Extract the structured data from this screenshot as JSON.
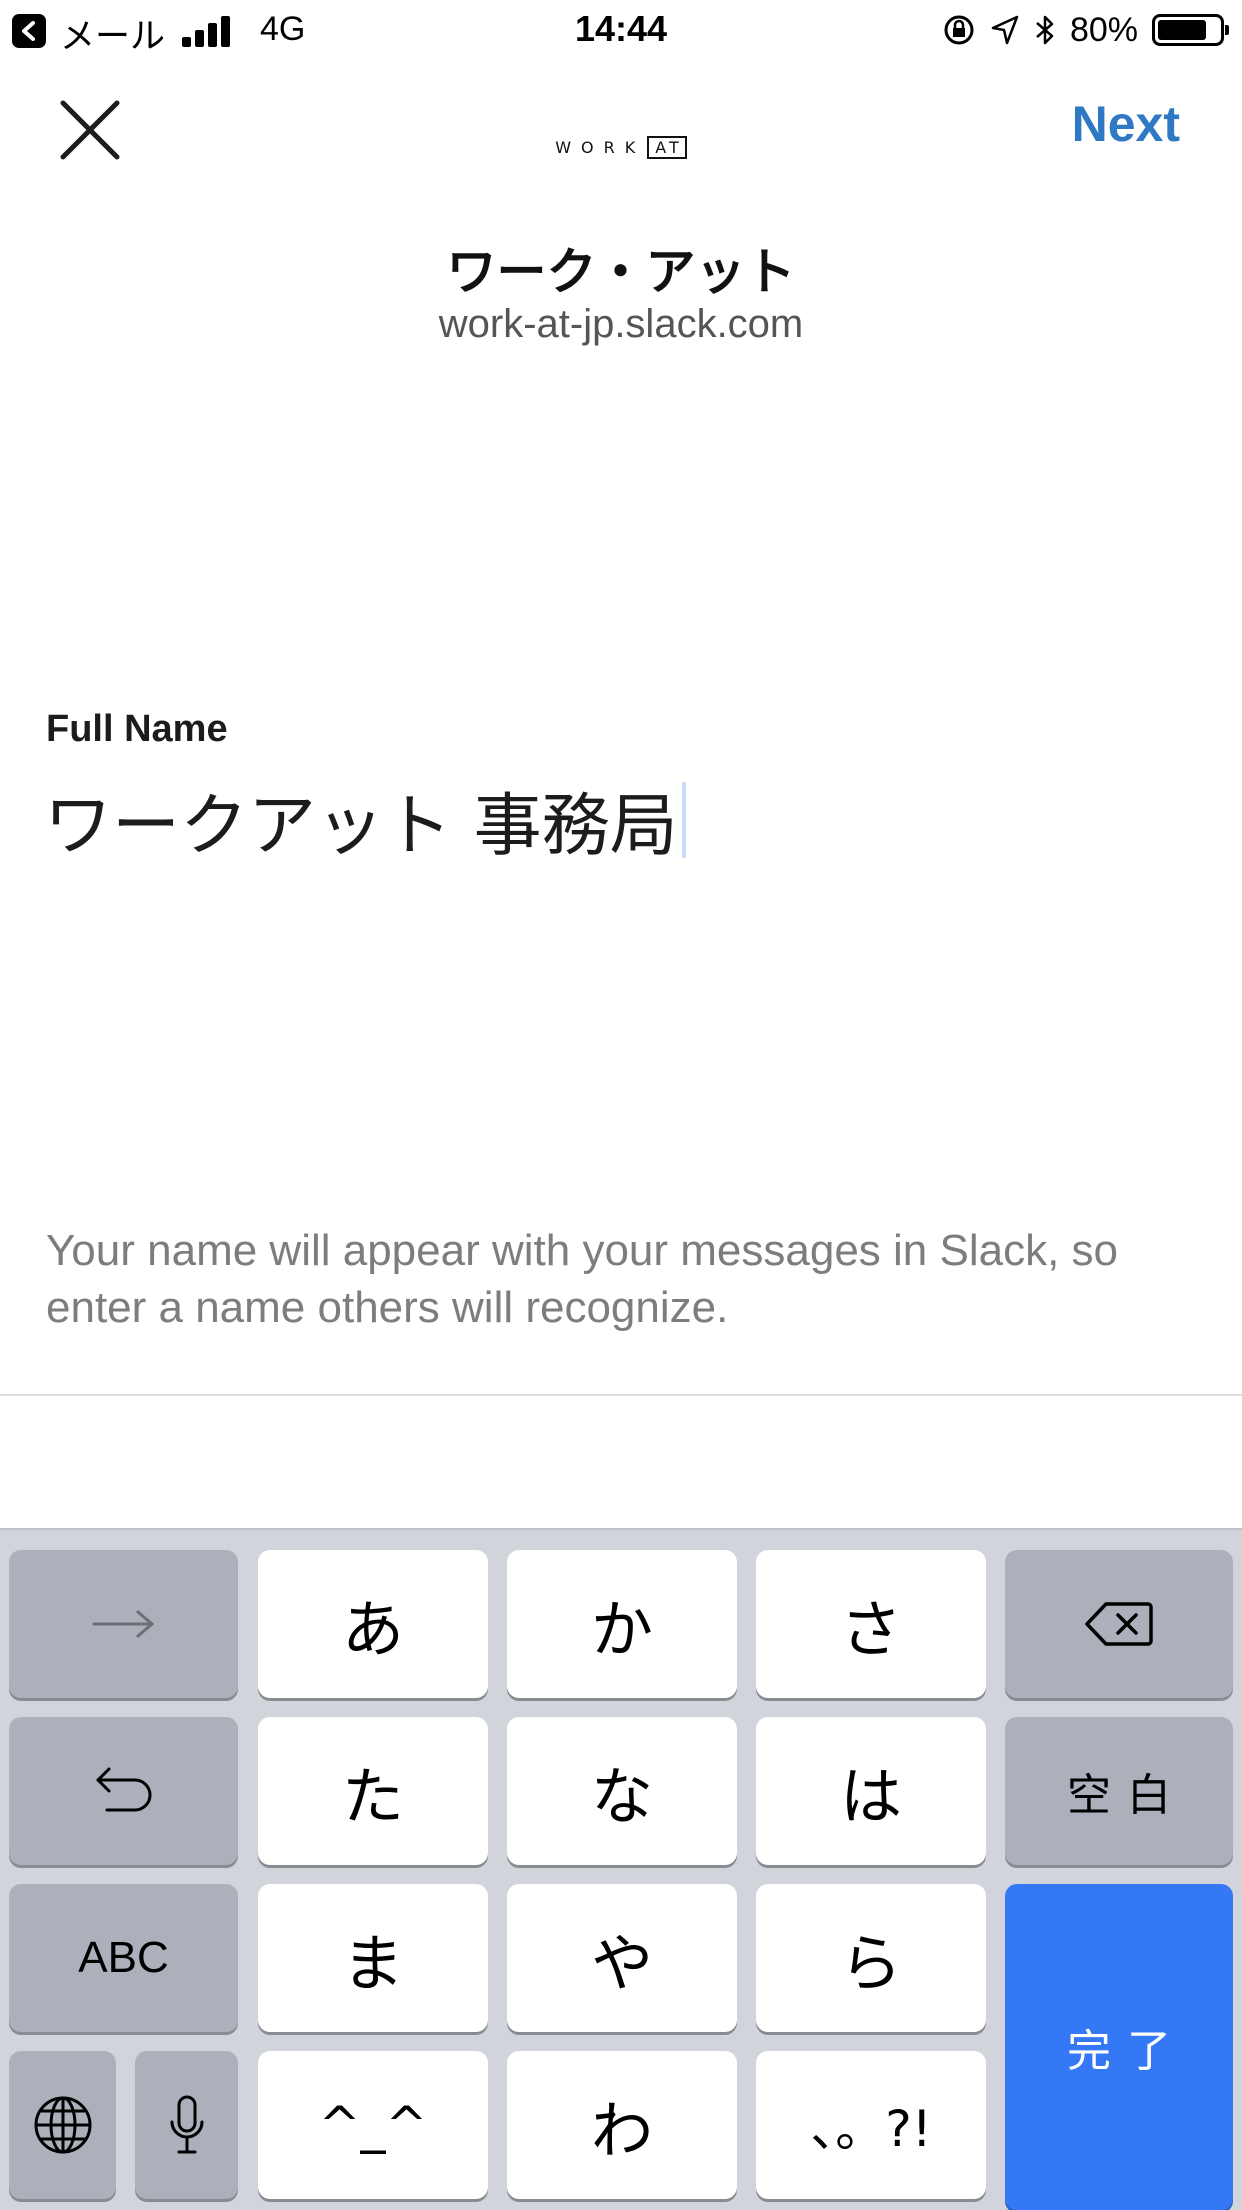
{
  "status_bar": {
    "back_app": "メール",
    "network": "4G",
    "time": "14:44",
    "battery_text": "80%",
    "battery_level": 0.8
  },
  "nav": {
    "logo_text": "WORK",
    "logo_badge": "AT",
    "next_label": "Next"
  },
  "team": {
    "name": "ワーク・アット",
    "url": "work-at-jp.slack.com"
  },
  "form": {
    "label": "Full Name",
    "value": "ワークアット 事務局",
    "hint": "Your name will appear with your messages in Slack, so enter a name others will recognize."
  },
  "keyboard": {
    "row1": [
      "あ",
      "か",
      "さ"
    ],
    "row2": [
      "た",
      "な",
      "は"
    ],
    "row3": [
      "ま",
      "や",
      "ら"
    ],
    "row4": [
      "^_^",
      "わ",
      "、。?!"
    ],
    "space_label": "空白",
    "abc_label": "ABC",
    "done_label": "完了",
    "accent_color": "#3478f6"
  },
  "colors": {
    "link": "#2f79c4",
    "hint_text": "#7d7d7d"
  }
}
